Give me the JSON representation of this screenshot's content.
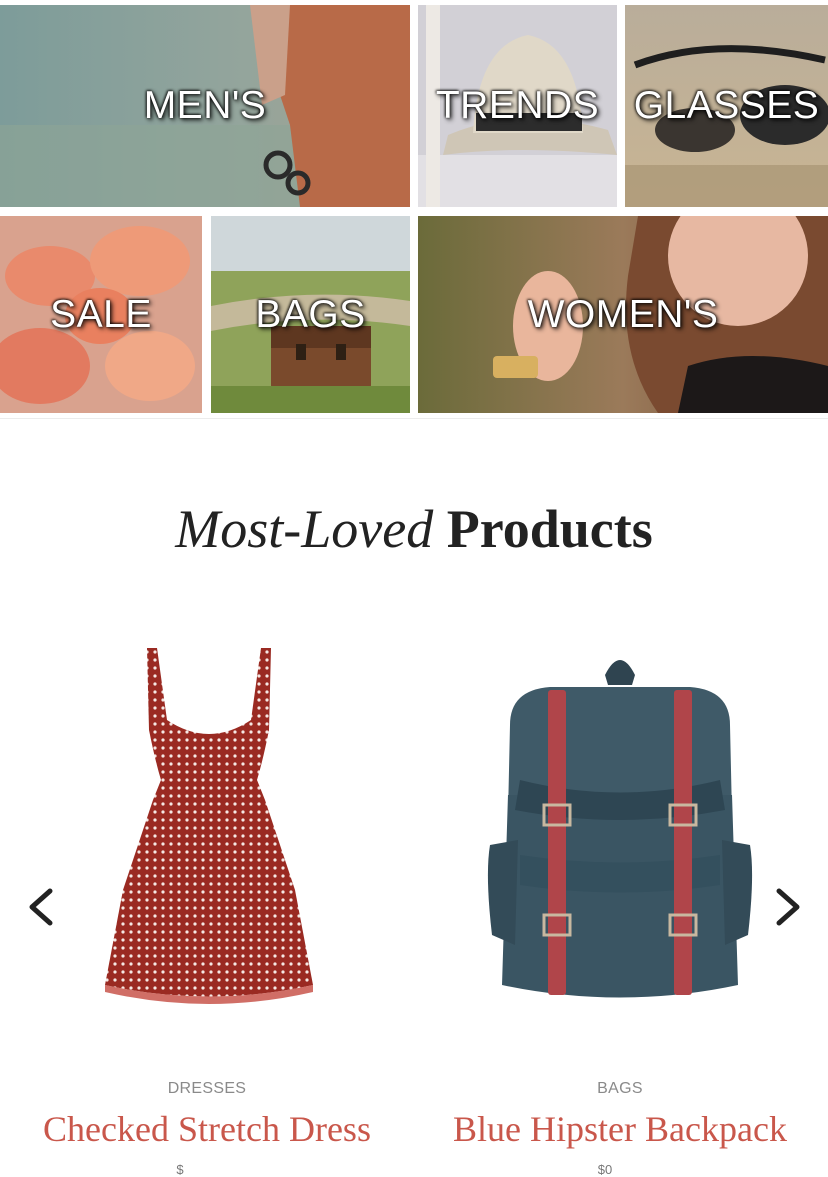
{
  "categories": {
    "mens": "MEN'S",
    "trends": "TRENDS",
    "glasses": "GLASSES",
    "sale": "SALE",
    "bags": "BAGS",
    "womens": "WOMEN'S"
  },
  "section": {
    "title_italic": "Most-Loved",
    "title_bold": "Products"
  },
  "carousel": {
    "prev_icon": "chevron-left-icon",
    "next_icon": "chevron-right-icon"
  },
  "products": [
    {
      "category": "DRESSES",
      "name": "Checked Stretch Dress",
      "price": "$",
      "image": "polka-dot-dress"
    },
    {
      "category": "BAGS",
      "name": "Blue Hipster Backpack",
      "price": "$0",
      "image": "blue-backpack"
    }
  ],
  "colors": {
    "accent": "#c9574b",
    "heading": "#222222",
    "muted": "#8a8a8a"
  }
}
